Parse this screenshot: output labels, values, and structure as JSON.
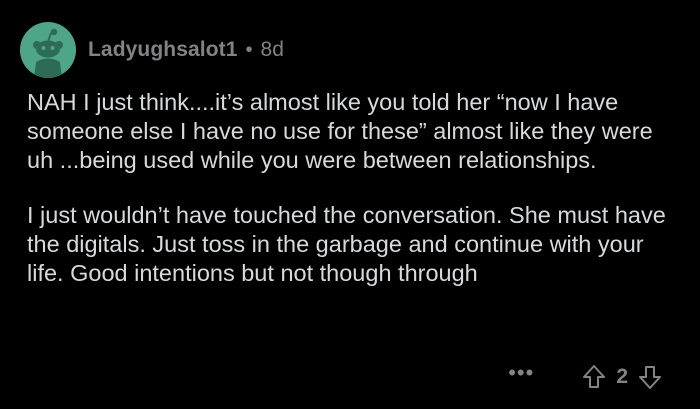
{
  "comment": {
    "author": "Ladyughsalot1",
    "separator": "•",
    "age": "8d",
    "paragraphs": [
      "NAH I just think....it’s almost like you told her “now I have someone else I have no use for these” almost like they were uh ...being used while you were between relationships.",
      "I just wouldn’t have touched the conversation. She must have the digitals. Just toss in the garbage and continue with your life. Good intentions but not though through"
    ],
    "more_label": "•••",
    "score": "2"
  },
  "icons": {
    "avatar": "snoo-avatar-icon",
    "upvote": "upvote-arrow-icon",
    "downvote": "downvote-arrow-icon",
    "more": "more-options-icon"
  },
  "colors": {
    "background": "#000000",
    "avatar_bg": "#4fa588",
    "text": "#d7dadc",
    "meta": "#818384"
  }
}
